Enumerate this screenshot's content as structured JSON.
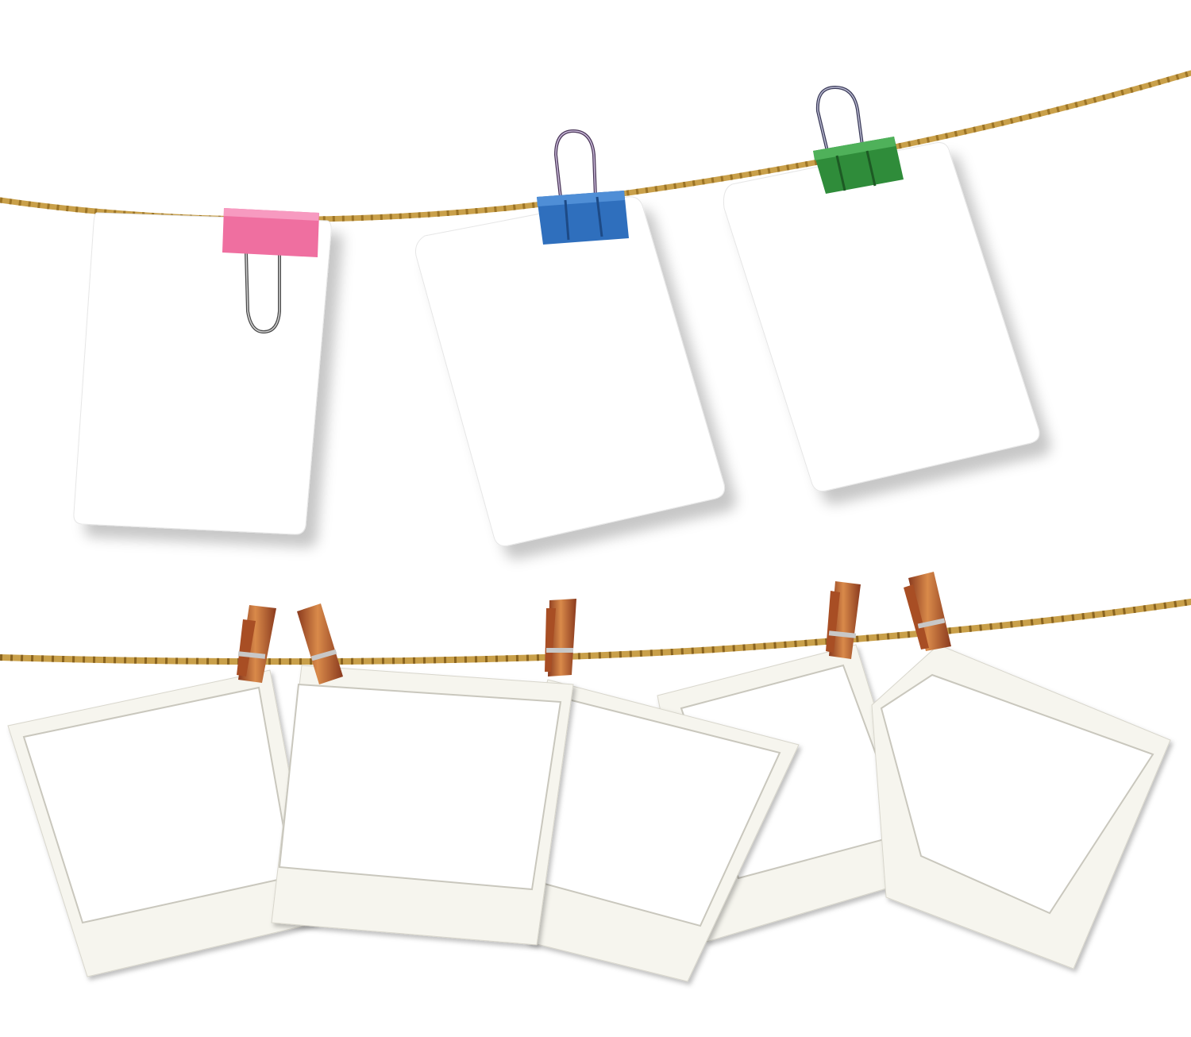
{
  "scene": {
    "background": "#ffffff",
    "rope_color": "#c9a04a",
    "rope_dark": "#9c7426",
    "card_color": "#ffffff",
    "polaroid_color": "#f6f5ee",
    "clip_colors": [
      "#ef6fa0",
      "#2f6fbd",
      "#2f8c3a"
    ],
    "clothespin_color": "#b8652f",
    "clothespin_dark": "#7a3520"
  }
}
